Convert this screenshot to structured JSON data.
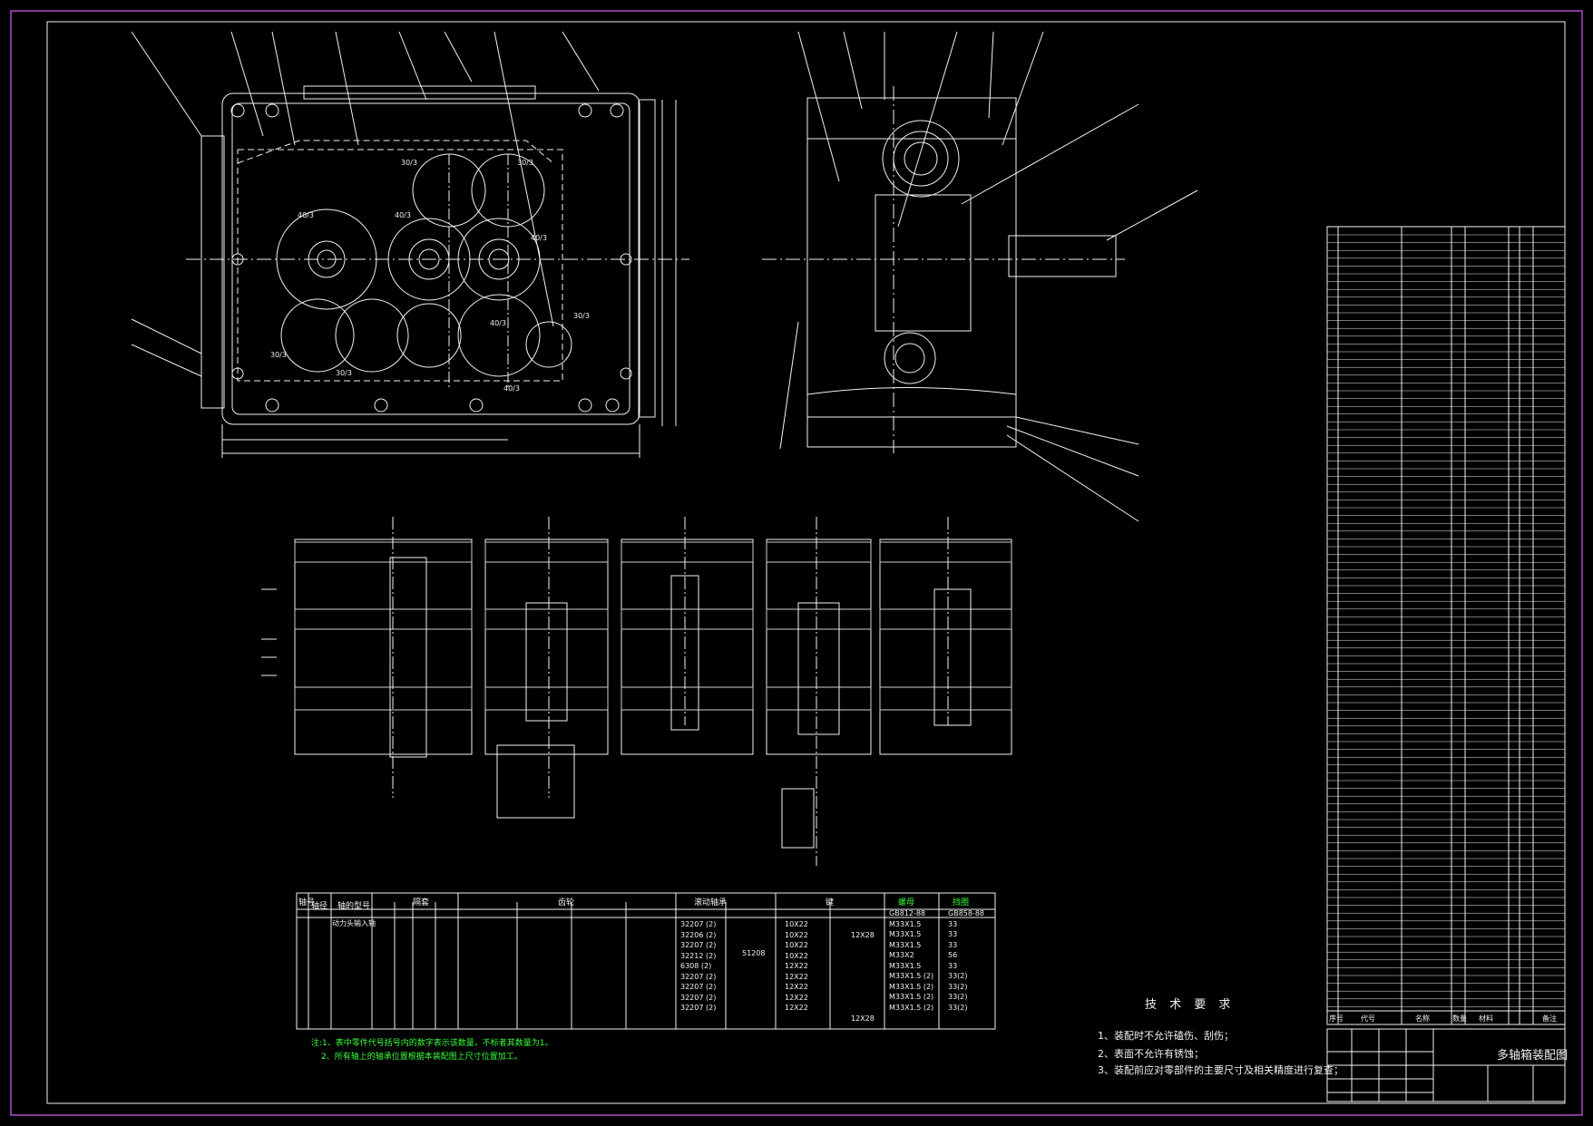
{
  "colors": {
    "background": "#000000",
    "lines": "#f2f2f2",
    "text_green": "#39ff39",
    "border": "#b04cc8"
  },
  "tech_requirements": {
    "title": "技 术 要 求",
    "items": [
      "1、装配时不允许磕伤、刮伤；",
      "2、表面不允许有锈蚀；",
      "3、装配前应对零部件的主要尺寸及相关精度进行复查；"
    ]
  },
  "table_notes": [
    "注:1、表中零件代号括号内的数字表示该数量，不标者其数量为1。",
    "2、所有轴上的轴承位置根据本装配图上尺寸位置加工。"
  ],
  "title_block": {
    "title": "多轴箱装配图"
  },
  "spindle_table": {
    "headers": [
      "轴号",
      "轴径",
      "轴的型号",
      "隔套",
      "齿轮",
      "滚动轴承",
      "键",
      "螺母",
      "挡圈"
    ],
    "first_row": "动力头输入轴",
    "bearing_column": [
      "32207 (2)",
      "32206 (2)",
      "32207 (2)",
      "32212 (2)",
      "6308 (2)",
      "32207 (2)",
      "32207 (2)",
      "32207 (2)",
      "32207 (2)"
    ],
    "bearing_extra": [
      "51208"
    ],
    "key_column": [
      "10X22",
      "10X22",
      "10X22",
      "10X22",
      "12X22",
      "12X22",
      "12X22",
      "12X22",
      "12X22"
    ],
    "key_extra": [
      "12X28",
      "12X28"
    ],
    "nut_column": [
      "GB812-88",
      "M33X1.5",
      "M33X1.5",
      "M33X1.5",
      "M33X2",
      "M33X1.5",
      "M33X1.5 (2)",
      "M33X1.5 (2)",
      "M33X1.5 (2)",
      "M33X1.5 (2)"
    ],
    "ring_column": [
      "GB858-88",
      "33",
      "33",
      "33",
      "56",
      "33",
      "33(2)",
      "33(2)",
      "33(2)",
      "33(2)"
    ]
  },
  "gear_labels": [
    "30/3",
    "30/3",
    "40/3",
    "40/3",
    "40/3",
    "30/3",
    "40/3",
    "30/3",
    "30/3",
    "40/3"
  ],
  "parts_list_header": [
    "序号",
    "代号",
    "名称",
    "数量",
    "材料",
    "备注"
  ]
}
